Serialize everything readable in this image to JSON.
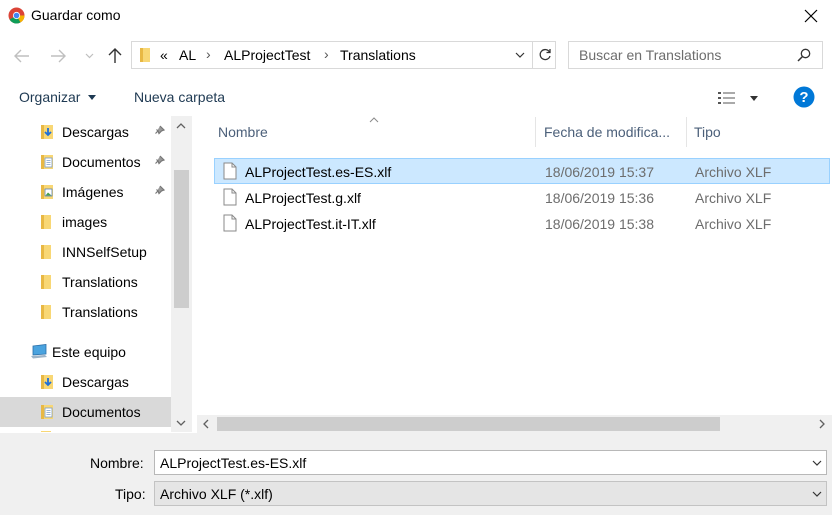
{
  "window": {
    "title": "Guardar como"
  },
  "address": {
    "overflow": "«",
    "crumbs": [
      "AL",
      "ALProjectTest",
      "Translations"
    ]
  },
  "search": {
    "placeholder": "Buscar en Translations"
  },
  "toolbar": {
    "organize": "Organizar",
    "new_folder": "Nueva carpeta"
  },
  "tree": {
    "items": [
      {
        "label": "Descargas",
        "icon": "download-folder-icon",
        "pinned": true
      },
      {
        "label": "Documentos",
        "icon": "documents-folder-icon",
        "pinned": true
      },
      {
        "label": "Imágenes",
        "icon": "pictures-folder-icon",
        "pinned": true
      },
      {
        "label": "images",
        "icon": "folder-icon",
        "pinned": false
      },
      {
        "label": "INNSelfSetup",
        "icon": "folder-icon",
        "pinned": false
      },
      {
        "label": "Translations",
        "icon": "folder-icon",
        "pinned": false
      },
      {
        "label": "Translations",
        "icon": "folder-icon",
        "pinned": false
      },
      {
        "label": "Este equipo",
        "icon": "computer-icon",
        "pinned": false
      },
      {
        "label": "Descargas",
        "icon": "download-folder-icon",
        "pinned": false
      },
      {
        "label": "Documentos",
        "icon": "documents-folder-icon",
        "pinned": false
      }
    ]
  },
  "list": {
    "columns": {
      "name": "Nombre",
      "date": "Fecha de modifica...",
      "type": "Tipo"
    },
    "files": [
      {
        "name": "ALProjectTest.es-ES.xlf",
        "date": "18/06/2019 15:37",
        "type": "Archivo XLF",
        "selected": true
      },
      {
        "name": "ALProjectTest.g.xlf",
        "date": "18/06/2019 15:36",
        "type": "Archivo XLF",
        "selected": false
      },
      {
        "name": "ALProjectTest.it-IT.xlf",
        "date": "18/06/2019 15:38",
        "type": "Archivo XLF",
        "selected": false
      }
    ]
  },
  "form": {
    "name_label": "Nombre:",
    "name_value": "ALProjectTest.es-ES.xlf",
    "type_label": "Tipo:",
    "type_value": "Archivo XLF (*.xlf)"
  },
  "colors": {
    "accent": "#0078d7",
    "selection": "#cce8ff",
    "toolbar_text": "#1e3952"
  }
}
